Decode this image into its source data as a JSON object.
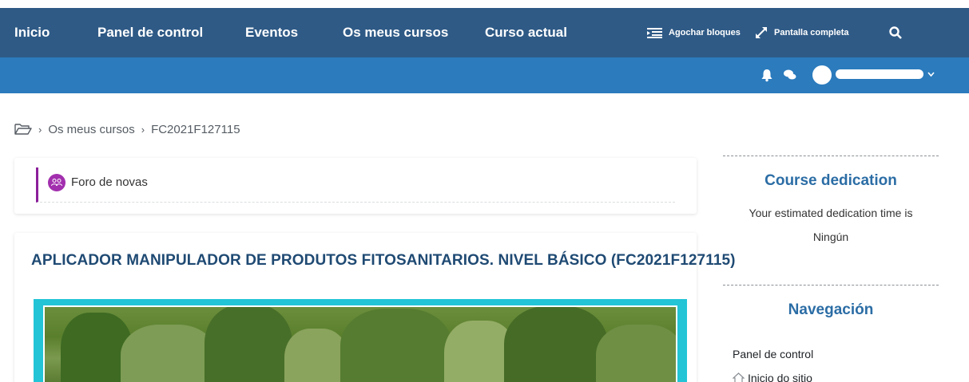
{
  "navbar": {
    "items": [
      "Inicio",
      "Panel de control",
      "Eventos",
      "Os meus cursos",
      "Curso actual"
    ],
    "hide_blocks": "Agochar bloques",
    "fullscreen": "Pantalla completa"
  },
  "colors": {
    "navbar": "#2f5a86",
    "subbar": "#2b7bbd",
    "forum_accent": "#8b1f9a",
    "title": "#1f4a73",
    "block_title": "#2b6da5"
  },
  "breadcrumb": {
    "items": [
      "Os meus cursos",
      "FC2021F127115"
    ]
  },
  "forum": {
    "label": "Foro de novas"
  },
  "course": {
    "title": "APLICADOR MANIPULADOR DE PRODUTOS FITOSANITARIOS. NIVEL BÁSICO (FC2021F127115)"
  },
  "dedication": {
    "title": "Course dedication",
    "text": "Your estimated dedication time is",
    "value": "Ningún"
  },
  "navigation": {
    "title": "Navegación",
    "items": [
      "Panel de control",
      "Inicio do sitio"
    ]
  }
}
